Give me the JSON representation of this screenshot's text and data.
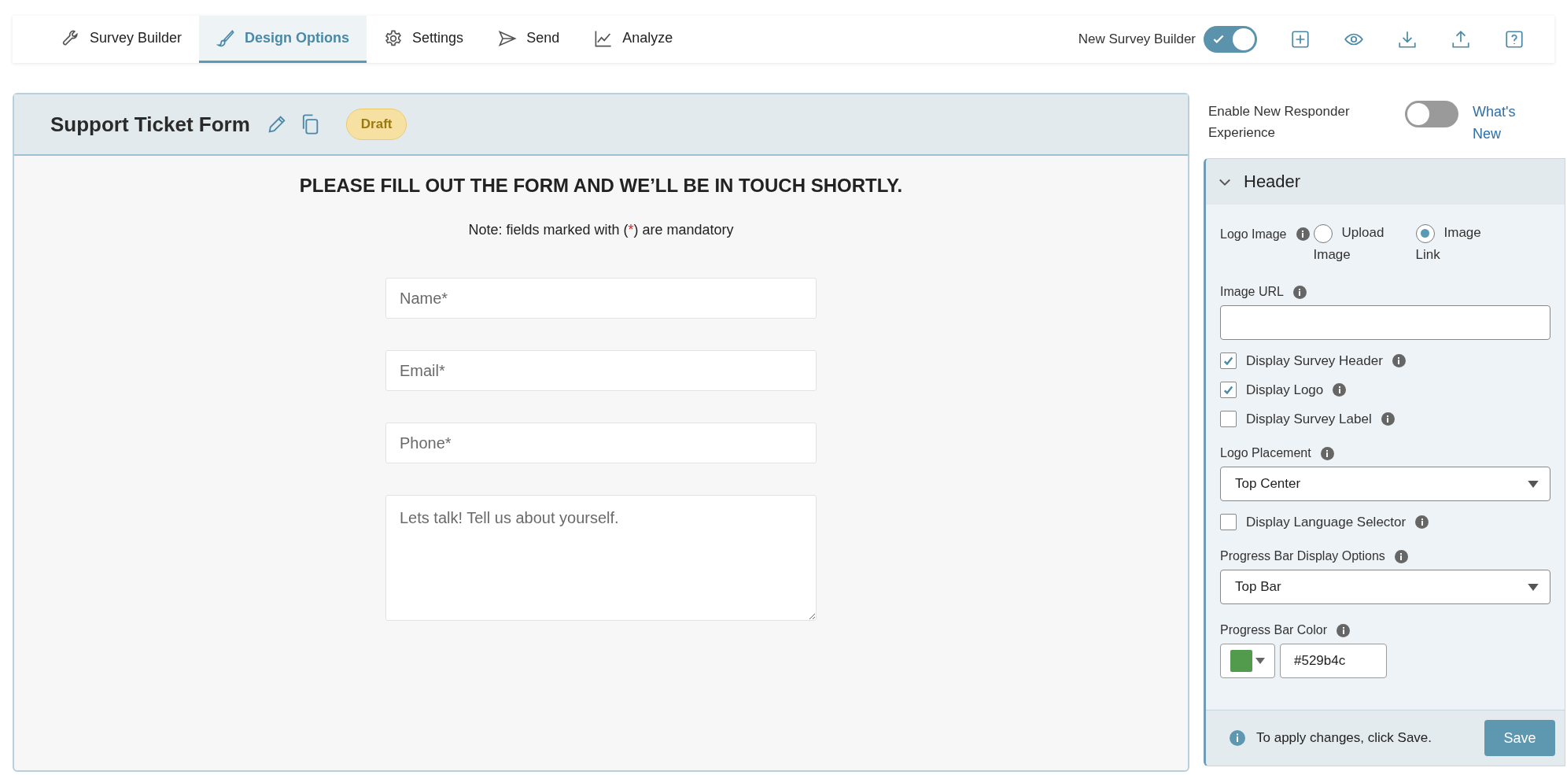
{
  "tabs": [
    {
      "label": "Survey Builder",
      "selected": false
    },
    {
      "label": "Design Options",
      "selected": true
    },
    {
      "label": "Settings",
      "selected": false
    },
    {
      "label": "Send",
      "selected": false
    },
    {
      "label": "Analyze",
      "selected": false
    }
  ],
  "builder_toggle": {
    "label": "New Survey Builder",
    "on": true
  },
  "survey": {
    "title": "Support Ticket Form",
    "status": "Draft"
  },
  "form": {
    "heading": "PLEASE FILL OUT THE FORM AND WE’LL BE IN TOUCH SHORTLY.",
    "note": {
      "before": "Note: fields marked with (",
      "mark": "*",
      "after": ") are mandatory"
    },
    "fields": [
      {
        "kind": "input",
        "placeholder": "Name*"
      },
      {
        "kind": "input",
        "placeholder": "Email*"
      },
      {
        "kind": "input",
        "placeholder": "Phone*"
      },
      {
        "kind": "textarea",
        "placeholder": "Lets talk! Tell us about yourself."
      }
    ]
  },
  "responder_toggle": {
    "label": "Enable New Responder Experience",
    "on": false,
    "link": "What's New"
  },
  "panel": {
    "title": "Header",
    "expanded": true,
    "logo_image": {
      "label": "Logo Image",
      "options": [
        {
          "label": "Upload Image",
          "selected": false
        },
        {
          "label": "Image Link",
          "selected": true
        }
      ]
    },
    "image_url": {
      "label": "Image URL"
    },
    "checks_a": [
      {
        "label": "Display Survey Header",
        "checked": true
      },
      {
        "label": "Display Logo",
        "checked": true
      },
      {
        "label": "Display Survey Label",
        "checked": false
      }
    ],
    "logo_placement": {
      "label": "Logo Placement",
      "value": "Top Center"
    },
    "checks_b": [
      {
        "label": "Display Language Selector",
        "checked": false
      }
    ],
    "progress_options": {
      "label": "Progress Bar Display Options",
      "value": "Top Bar"
    },
    "progress_color": {
      "label": "Progress Bar Color",
      "value": "#529b4c"
    }
  },
  "footer": {
    "message": "To apply changes, click Save.",
    "button": "Save"
  }
}
